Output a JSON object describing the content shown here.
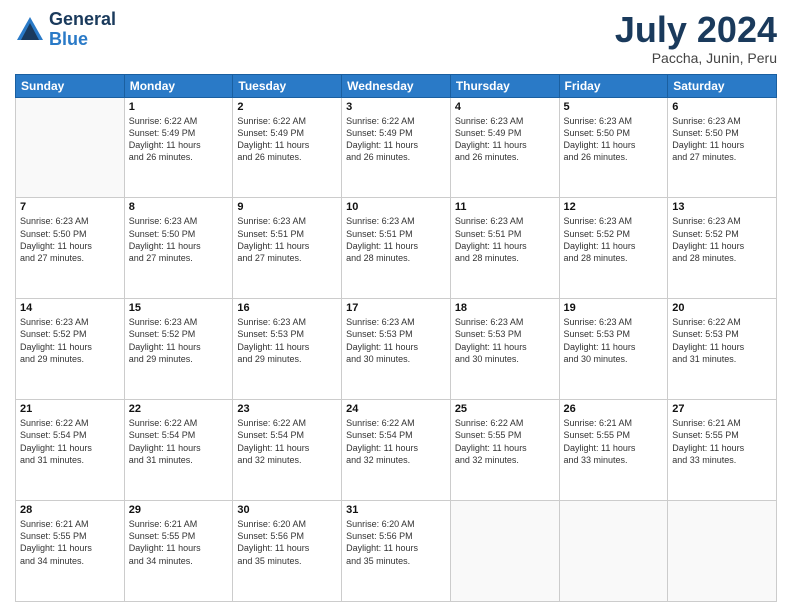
{
  "header": {
    "logo_line1": "General",
    "logo_line2": "Blue",
    "month_year": "July 2024",
    "location": "Paccha, Junin, Peru"
  },
  "days_of_week": [
    "Sunday",
    "Monday",
    "Tuesday",
    "Wednesday",
    "Thursday",
    "Friday",
    "Saturday"
  ],
  "weeks": [
    [
      {
        "day": "",
        "info": ""
      },
      {
        "day": "1",
        "info": "Sunrise: 6:22 AM\nSunset: 5:49 PM\nDaylight: 11 hours\nand 26 minutes."
      },
      {
        "day": "2",
        "info": "Sunrise: 6:22 AM\nSunset: 5:49 PM\nDaylight: 11 hours\nand 26 minutes."
      },
      {
        "day": "3",
        "info": "Sunrise: 6:22 AM\nSunset: 5:49 PM\nDaylight: 11 hours\nand 26 minutes."
      },
      {
        "day": "4",
        "info": "Sunrise: 6:23 AM\nSunset: 5:49 PM\nDaylight: 11 hours\nand 26 minutes."
      },
      {
        "day": "5",
        "info": "Sunrise: 6:23 AM\nSunset: 5:50 PM\nDaylight: 11 hours\nand 26 minutes."
      },
      {
        "day": "6",
        "info": "Sunrise: 6:23 AM\nSunset: 5:50 PM\nDaylight: 11 hours\nand 27 minutes."
      }
    ],
    [
      {
        "day": "7",
        "info": "Sunrise: 6:23 AM\nSunset: 5:50 PM\nDaylight: 11 hours\nand 27 minutes."
      },
      {
        "day": "8",
        "info": "Sunrise: 6:23 AM\nSunset: 5:50 PM\nDaylight: 11 hours\nand 27 minutes."
      },
      {
        "day": "9",
        "info": "Sunrise: 6:23 AM\nSunset: 5:51 PM\nDaylight: 11 hours\nand 27 minutes."
      },
      {
        "day": "10",
        "info": "Sunrise: 6:23 AM\nSunset: 5:51 PM\nDaylight: 11 hours\nand 28 minutes."
      },
      {
        "day": "11",
        "info": "Sunrise: 6:23 AM\nSunset: 5:51 PM\nDaylight: 11 hours\nand 28 minutes."
      },
      {
        "day": "12",
        "info": "Sunrise: 6:23 AM\nSunset: 5:52 PM\nDaylight: 11 hours\nand 28 minutes."
      },
      {
        "day": "13",
        "info": "Sunrise: 6:23 AM\nSunset: 5:52 PM\nDaylight: 11 hours\nand 28 minutes."
      }
    ],
    [
      {
        "day": "14",
        "info": "Sunrise: 6:23 AM\nSunset: 5:52 PM\nDaylight: 11 hours\nand 29 minutes."
      },
      {
        "day": "15",
        "info": "Sunrise: 6:23 AM\nSunset: 5:52 PM\nDaylight: 11 hours\nand 29 minutes."
      },
      {
        "day": "16",
        "info": "Sunrise: 6:23 AM\nSunset: 5:53 PM\nDaylight: 11 hours\nand 29 minutes."
      },
      {
        "day": "17",
        "info": "Sunrise: 6:23 AM\nSunset: 5:53 PM\nDaylight: 11 hours\nand 30 minutes."
      },
      {
        "day": "18",
        "info": "Sunrise: 6:23 AM\nSunset: 5:53 PM\nDaylight: 11 hours\nand 30 minutes."
      },
      {
        "day": "19",
        "info": "Sunrise: 6:23 AM\nSunset: 5:53 PM\nDaylight: 11 hours\nand 30 minutes."
      },
      {
        "day": "20",
        "info": "Sunrise: 6:22 AM\nSunset: 5:53 PM\nDaylight: 11 hours\nand 31 minutes."
      }
    ],
    [
      {
        "day": "21",
        "info": "Sunrise: 6:22 AM\nSunset: 5:54 PM\nDaylight: 11 hours\nand 31 minutes."
      },
      {
        "day": "22",
        "info": "Sunrise: 6:22 AM\nSunset: 5:54 PM\nDaylight: 11 hours\nand 31 minutes."
      },
      {
        "day": "23",
        "info": "Sunrise: 6:22 AM\nSunset: 5:54 PM\nDaylight: 11 hours\nand 32 minutes."
      },
      {
        "day": "24",
        "info": "Sunrise: 6:22 AM\nSunset: 5:54 PM\nDaylight: 11 hours\nand 32 minutes."
      },
      {
        "day": "25",
        "info": "Sunrise: 6:22 AM\nSunset: 5:55 PM\nDaylight: 11 hours\nand 32 minutes."
      },
      {
        "day": "26",
        "info": "Sunrise: 6:21 AM\nSunset: 5:55 PM\nDaylight: 11 hours\nand 33 minutes."
      },
      {
        "day": "27",
        "info": "Sunrise: 6:21 AM\nSunset: 5:55 PM\nDaylight: 11 hours\nand 33 minutes."
      }
    ],
    [
      {
        "day": "28",
        "info": "Sunrise: 6:21 AM\nSunset: 5:55 PM\nDaylight: 11 hours\nand 34 minutes."
      },
      {
        "day": "29",
        "info": "Sunrise: 6:21 AM\nSunset: 5:55 PM\nDaylight: 11 hours\nand 34 minutes."
      },
      {
        "day": "30",
        "info": "Sunrise: 6:20 AM\nSunset: 5:56 PM\nDaylight: 11 hours\nand 35 minutes."
      },
      {
        "day": "31",
        "info": "Sunrise: 6:20 AM\nSunset: 5:56 PM\nDaylight: 11 hours\nand 35 minutes."
      },
      {
        "day": "",
        "info": ""
      },
      {
        "day": "",
        "info": ""
      },
      {
        "day": "",
        "info": ""
      }
    ]
  ]
}
